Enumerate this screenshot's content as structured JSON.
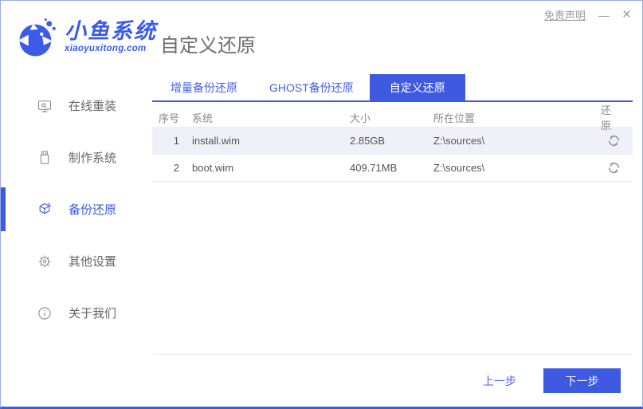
{
  "window": {
    "disclaimer": "免责声明",
    "minimize": "—",
    "close": "×"
  },
  "header": {
    "brand_title": "小鱼系统",
    "brand_domain": "xiaoyuxitong.com",
    "page_title": "自定义还原"
  },
  "sidebar": {
    "items": [
      {
        "label": "在线重装",
        "icon": "monitor-icon",
        "active": false
      },
      {
        "label": "制作系统",
        "icon": "usb-icon",
        "active": false
      },
      {
        "label": "备份还原",
        "icon": "backup-cube-icon",
        "active": true
      },
      {
        "label": "其他设置",
        "icon": "gear-icon",
        "active": false
      },
      {
        "label": "关于我们",
        "icon": "info-icon",
        "active": false
      }
    ]
  },
  "tabs": [
    {
      "label": "增量备份还原",
      "active": false
    },
    {
      "label": "GHOST备份还原",
      "active": false
    },
    {
      "label": "自定义还原",
      "active": true
    }
  ],
  "table": {
    "headers": [
      "序号",
      "系统",
      "大小",
      "所在位置",
      "还原"
    ],
    "rows": [
      {
        "no": "1",
        "system": "install.wim",
        "size": "2.85GB",
        "location": "Z:\\sources\\"
      },
      {
        "no": "2",
        "system": "boot.wim",
        "size": "409.71MB",
        "location": "Z:\\sources\\"
      }
    ]
  },
  "footer": {
    "prev_label": "上一步",
    "next_label": "下一步"
  },
  "colors": {
    "accent": "#3d5ae1",
    "brand_blue": "#3b5be8",
    "tab_link_blue": "#4262e2",
    "row_alt_bg": "#f0f1f8",
    "muted_text": "#8a8a8a"
  }
}
